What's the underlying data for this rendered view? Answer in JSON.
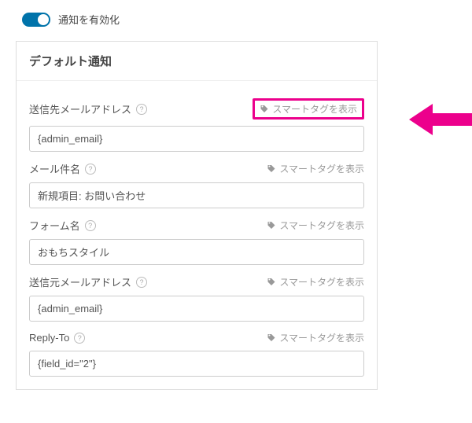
{
  "toggle": {
    "label": "通知を有効化"
  },
  "panel": {
    "title": "デフォルト通知"
  },
  "fields": {
    "to": {
      "label": "送信先メールアドレス",
      "smart_tag": "スマートタグを表示",
      "value": "{admin_email}"
    },
    "subject": {
      "label": "メール件名",
      "smart_tag": "スマートタグを表示",
      "value": "新規項目: お問い合わせ"
    },
    "form_name": {
      "label": "フォーム名",
      "smart_tag": "スマートタグを表示",
      "value": "おもちスタイル"
    },
    "from": {
      "label": "送信元メールアドレス",
      "smart_tag": "スマートタグを表示",
      "value": "{admin_email}"
    },
    "reply_to": {
      "label": "Reply-To",
      "smart_tag": "スマートタグを表示",
      "value": "{field_id=\"2\"}"
    }
  }
}
